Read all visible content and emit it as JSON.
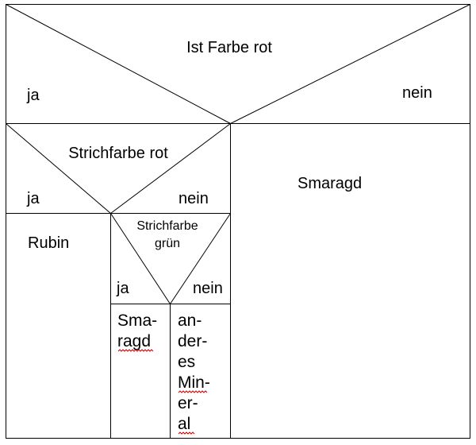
{
  "root": {
    "condition": "Ist Farbe rot",
    "yes": "ja",
    "no": "nein"
  },
  "level1_yes": {
    "condition": "Strichfarbe rot",
    "yes": "ja",
    "no": "nein"
  },
  "level1_no": {
    "result": "Smaragd"
  },
  "level2_yes": {
    "result": "Rubin"
  },
  "level2_no": {
    "condition_line1": "Strichfarbe",
    "condition_line2": "grün",
    "yes": "ja",
    "no": "nein"
  },
  "level3_yes": {
    "result_lines": [
      "Sma-",
      "ragd"
    ]
  },
  "level3_no": {
    "result_lines": [
      "an-",
      "der-",
      "es",
      "Min-",
      "er-",
      "al"
    ]
  },
  "colors": {
    "line": "#000000",
    "background": "#ffffff",
    "spellcheck_underline": "#cc0000"
  }
}
